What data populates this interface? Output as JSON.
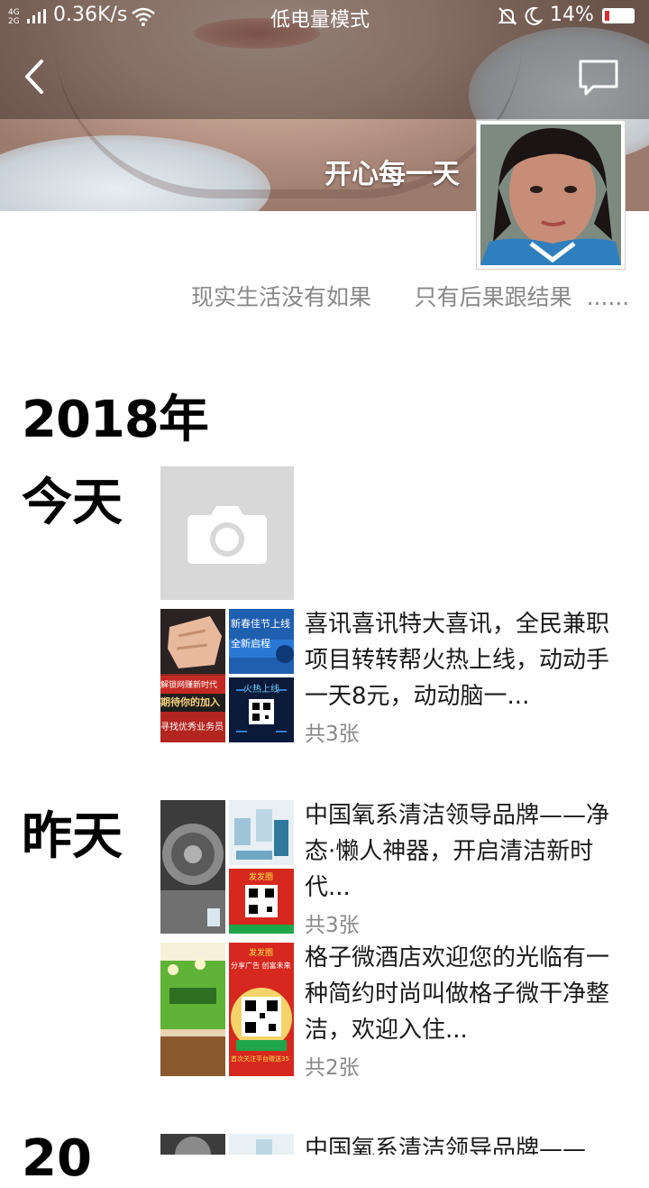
{
  "status_bar": {
    "network": "4G 2G",
    "speed": "0.36K/s",
    "mode": "低电量模式",
    "battery": "14%"
  },
  "profile": {
    "name": "开心每一天",
    "signature": "现实生活没有如果      只有后果跟结果  ......"
  },
  "timeline": {
    "year": "2018年",
    "sections": [
      {
        "day": "今天",
        "posts": [
          {
            "text": "喜讯喜讯特大喜讯，全民兼职项目转转帮火热上线，动动手一天8元，动动脑一...",
            "count": "共3张",
            "thumb_texts": [
              "新春佳节上线",
              "全新启程",
              "火热上线",
              "解锁网赚新时代",
              "期待你的加入",
              "寻找优秀业务员"
            ]
          }
        ]
      },
      {
        "day": "昨天",
        "posts": [
          {
            "text": "中国氧系清洁领导品牌——净态·懒人神器，开启清洁新时代...",
            "count": "共3张",
            "thumb_texts": [
              "发发圈"
            ]
          },
          {
            "text": "格子微酒店欢迎您的光临有一种简约时尚叫做格子微干净整洁，欢迎入住...",
            "count": "共2张",
            "thumb_texts": [
              "发发圈",
              "分享广告 创富未来",
              "首次关注平台赠送35"
            ]
          }
        ]
      },
      {
        "day": "20",
        "posts": [
          {
            "text": "中国氧系清洁领导品牌——"
          }
        ]
      }
    ]
  },
  "colors": {
    "accent_red": "#d32f2f",
    "text_gray": "#888888",
    "placeholder_gray": "#d8d8d8"
  }
}
